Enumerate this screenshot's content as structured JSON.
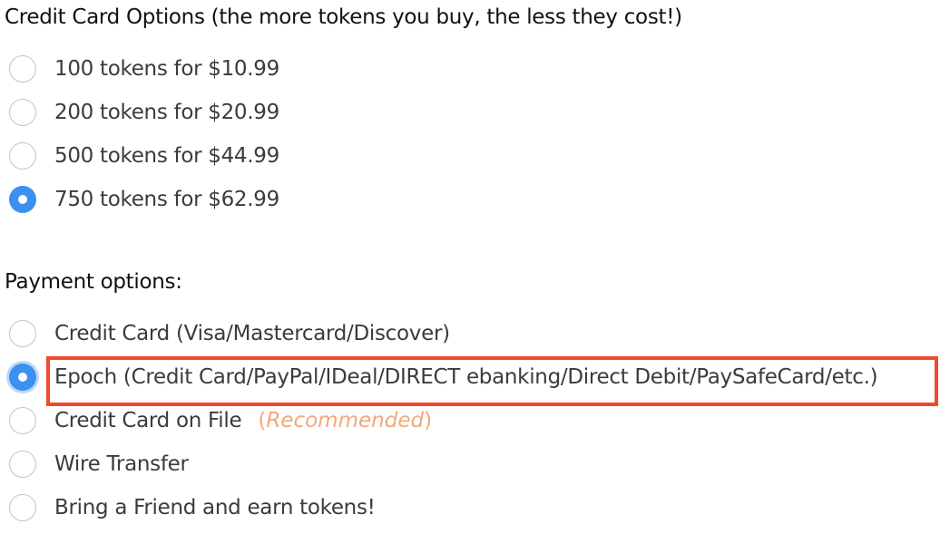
{
  "token_section": {
    "title": "Credit Card Options (the more tokens you buy, the less they cost!)",
    "options": [
      {
        "label": "100 tokens for $10.99",
        "tokens": 100,
        "price": "$10.99",
        "selected": false
      },
      {
        "label": "200 tokens for $20.99",
        "tokens": 200,
        "price": "$20.99",
        "selected": false
      },
      {
        "label": "500 tokens for $44.99",
        "tokens": 500,
        "price": "$44.99",
        "selected": false
      },
      {
        "label": "750 tokens for $62.99",
        "tokens": 750,
        "price": "$62.99",
        "selected": true
      }
    ]
  },
  "payment_section": {
    "title": "Payment options:",
    "options": [
      {
        "label": "Credit Card (Visa/Mastercard/Discover)",
        "selected": false
      },
      {
        "label": "Epoch (Credit Card/PayPal/IDeal/DIRECT ebanking/Direct Debit/PaySafeCard/etc.)",
        "selected": true,
        "highlighted": true
      },
      {
        "label": "Credit Card on File",
        "selected": false,
        "badge_open": "(",
        "badge": "Recommended",
        "badge_close": ")"
      },
      {
        "label": "Wire Transfer",
        "selected": false
      },
      {
        "label": "Bring a Friend and earn tokens!",
        "selected": false
      }
    ]
  },
  "colors": {
    "radio_selected": "#3d8ff0",
    "highlight_border": "#f04a2c",
    "recommended_text": "#f4a77a"
  }
}
